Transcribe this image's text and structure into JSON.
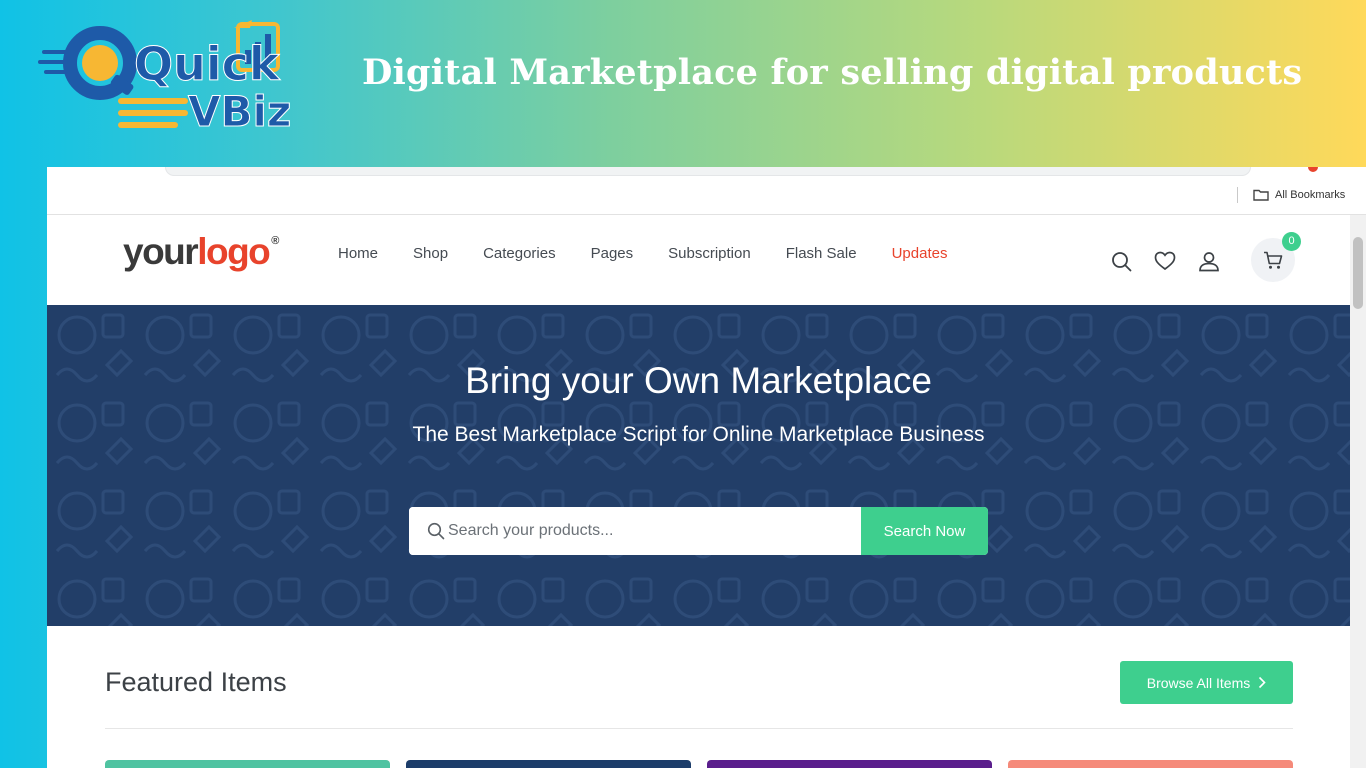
{
  "banner": {
    "brand_icon": "quickvbiz-logo",
    "brand_line1": "Quick",
    "brand_line2": "VBiz",
    "title": "Digital Marketplace for selling digital products"
  },
  "browser": {
    "bookmarks_label": "All Bookmarks",
    "bookmarks_icon": "folder-icon"
  },
  "site": {
    "logo_part1": "your",
    "logo_part2": "logo",
    "logo_mark": "®",
    "nav": [
      {
        "label": "Home"
      },
      {
        "label": "Shop"
      },
      {
        "label": "Categories"
      },
      {
        "label": "Pages"
      },
      {
        "label": "Subscription"
      },
      {
        "label": "Flash Sale"
      },
      {
        "label": "Updates"
      }
    ],
    "cart_count": "0",
    "icons": [
      "search-icon",
      "heart-icon",
      "user-icon",
      "cart-icon"
    ]
  },
  "hero": {
    "title": "Bring your Own Marketplace",
    "subtitle": "The Best Marketplace Script for Online Marketplace Business",
    "search_placeholder": "Search your products...",
    "search_button": "Search Now"
  },
  "featured": {
    "title": "Featured Items",
    "browse_button": "Browse All Items"
  },
  "colors": {
    "accent_green": "#3ecf8e",
    "accent_red": "#e8432c",
    "hero_bg": "#223e68"
  }
}
